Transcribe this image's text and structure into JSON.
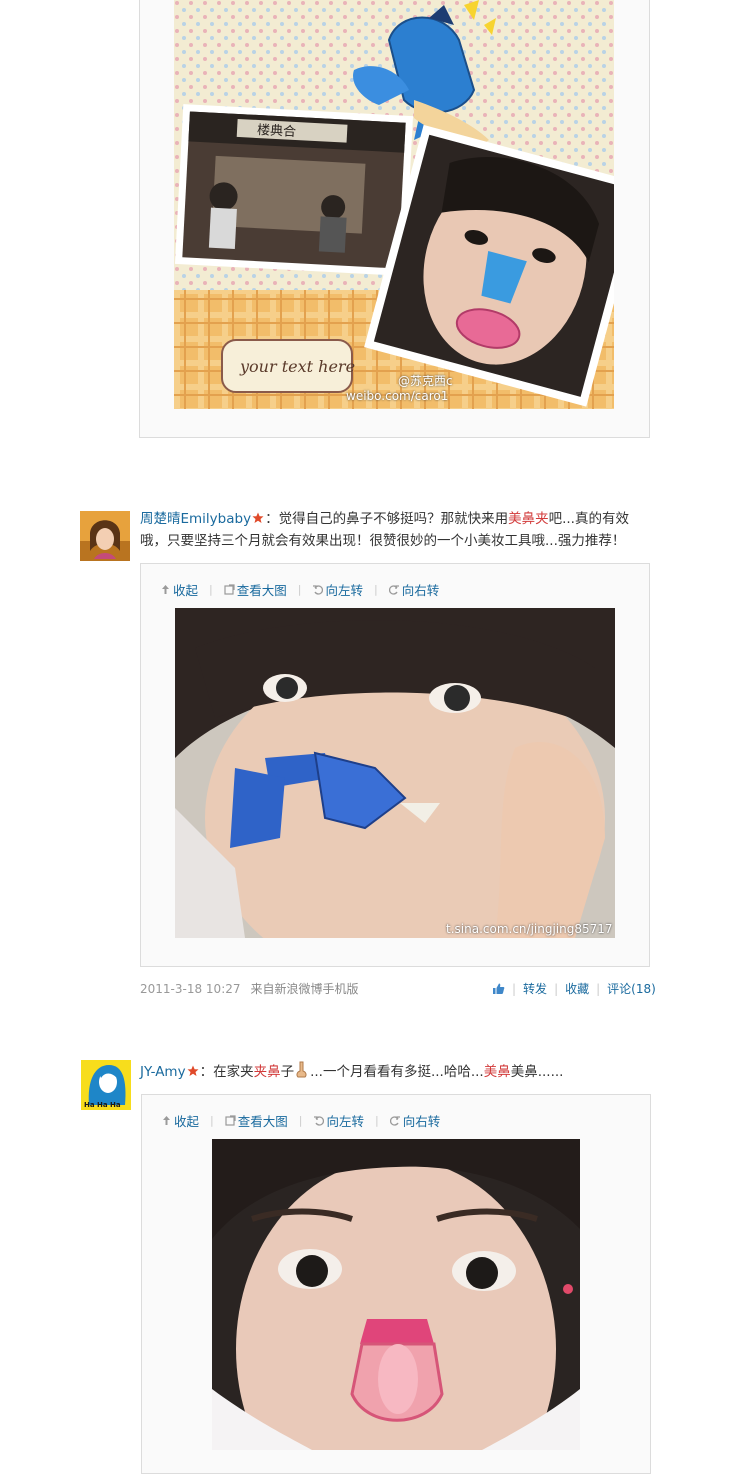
{
  "post1": {
    "watermark_line1": "@苏克西c",
    "watermark_line2": "weibo.com/caro1",
    "frame_caption": "your text here",
    "sign_text": "楼典合"
  },
  "post2": {
    "username": "周楚晴Emilybaby",
    "colon": "：",
    "text_a": "觉得自己的鼻子不够挺吗？那就快来用",
    "keyword": "美鼻夹",
    "text_b": "吧...真的有效哦，只要坚持三个月就会有效果出现！很赞很妙的一个小美妆工具哦...强力推荐！",
    "actions": [
      "收起",
      "查看大图",
      "向左转",
      "向右转"
    ],
    "watermark": "t.sina.com.cn/jingjing85717",
    "time": "2011-3-18 10:27",
    "source": "来自新浪微博手机版",
    "stats": {
      "forward": "转发",
      "favorite": "收藏",
      "comment": "评论(18)"
    }
  },
  "post3": {
    "username": "JY-Amy",
    "colon": "：",
    "text_a": "在家夹",
    "keyword1": "夹鼻",
    "text_b": "子",
    "text_c": "...一个月看看有多挺...哈哈...",
    "keyword2": "美鼻",
    "text_d": "美鼻......",
    "actions": [
      "收起",
      "查看大图",
      "向左转",
      "向右转"
    ],
    "avatar_text": "Ha Ha Ha"
  },
  "colors": {
    "link": "#1a6a9e",
    "keyword": "#d23a3a",
    "border": "#dcdcdc",
    "box_bg": "#fafafa"
  },
  "icons": [
    "collapse-up-icon",
    "zoom-icon",
    "rotate-left-icon",
    "rotate-right-icon",
    "verified-star-icon",
    "like-thumb-icon",
    "nose-emoji-icon"
  ]
}
